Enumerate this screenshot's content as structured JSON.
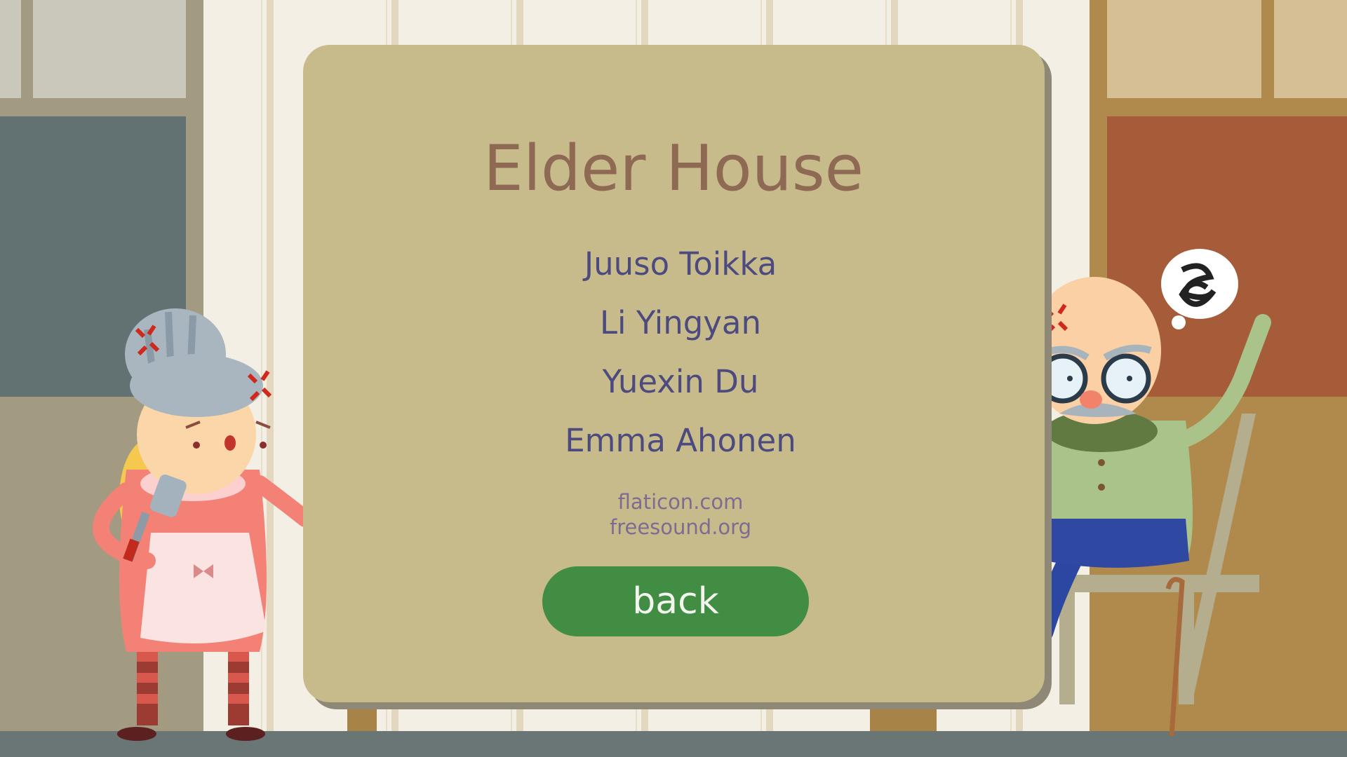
{
  "game": {
    "title": "Elder House",
    "credits": {
      "names": [
        "Juuso Toikka",
        "Li Yingyan",
        "Yuexin Du",
        "Emma Ahonen"
      ],
      "sources": [
        "flaticon.com",
        "freesound.org"
      ]
    },
    "back_label": "back"
  },
  "colors": {
    "dialog_bg": "#c8bb8b",
    "title": "#8e6a54",
    "names": "#4c4a7e",
    "sources": "#7e6b91",
    "button": "#408d43"
  },
  "icons": [
    "grandma-character",
    "grandpa-character",
    "angry-mark-icon",
    "scribble-speech-bubble-icon",
    "spatula-icon",
    "walking-cane-icon",
    "chair"
  ]
}
